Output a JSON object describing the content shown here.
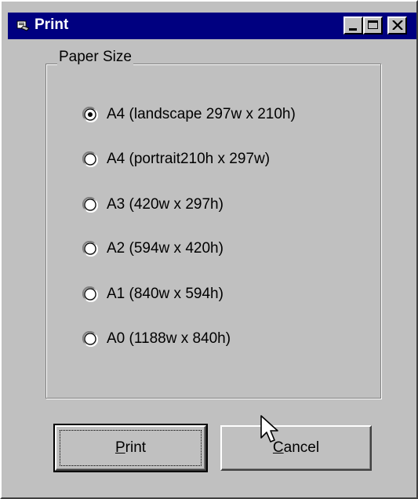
{
  "window": {
    "title": "Print",
    "controls": {
      "minimize": "minimize-icon",
      "maximize": "maximize-icon",
      "close": "close-icon"
    }
  },
  "paper_size": {
    "group_label": "Paper Size",
    "selected_index": 0,
    "options": [
      "A4 (landscape 297w x 210h)",
      "A4 (portrait210h x 297w)",
      "A3 (420w x 297h)",
      "A2 (594w x 420h)",
      "A1 (840w x 594h)",
      "A0 (1188w x 840h)"
    ]
  },
  "buttons": {
    "print": {
      "label": "Print",
      "accel": "P",
      "rest": "rint"
    },
    "cancel": {
      "label": "Cancel",
      "accel": "C",
      "rest": "ancel"
    }
  },
  "colors": {
    "titlebar": "#000080",
    "face": "#c0c0c0"
  }
}
